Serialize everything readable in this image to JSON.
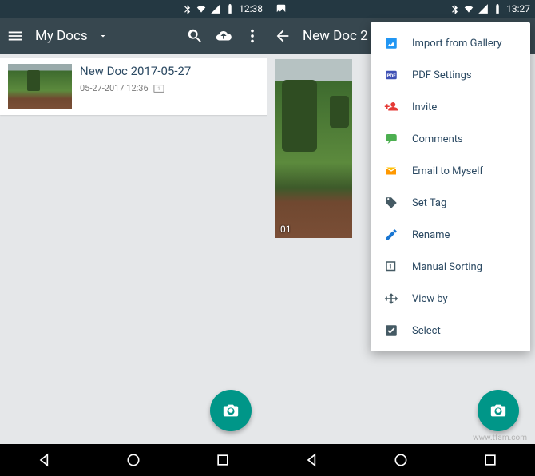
{
  "left": {
    "status_time": "12:38",
    "appbar_title": "My Docs",
    "doc": {
      "title": "New Doc 2017-05-27",
      "sub": "05-27-2017 12:36"
    }
  },
  "right": {
    "status_time": "13:27",
    "appbar_title": "New Doc 2",
    "preview_num": "01",
    "menu": [
      "Import from Gallery",
      "PDF Settings",
      "Invite",
      "Comments",
      "Email to Myself",
      "Set Tag",
      "Rename",
      "Manual Sorting",
      "View by",
      "Select"
    ]
  },
  "watermark": "www.tfam.com"
}
